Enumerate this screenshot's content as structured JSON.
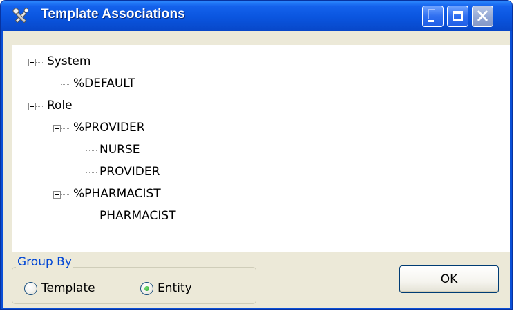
{
  "window": {
    "title": "Template Associations",
    "icon": "tools-icon",
    "controls": [
      "minimize-icon",
      "maximize-icon",
      "close-icon"
    ]
  },
  "tree": {
    "nodes": [
      {
        "label": "System",
        "level": 0,
        "expanded": true
      },
      {
        "label": "%DEFAULT",
        "level": 1
      },
      {
        "label": "Role",
        "level": 0,
        "expanded": true
      },
      {
        "label": "%PROVIDER",
        "level": 1,
        "expanded": true
      },
      {
        "label": "NURSE",
        "level": 2
      },
      {
        "label": "PROVIDER",
        "level": 2
      },
      {
        "label": "%PHARMACIST",
        "level": 1,
        "expanded": true
      },
      {
        "label": "PHARMACIST",
        "level": 2
      }
    ]
  },
  "group_by": {
    "title": "Group By",
    "options": [
      {
        "label": "Template",
        "checked": false
      },
      {
        "label": "Entity",
        "checked": true
      }
    ]
  },
  "buttons": {
    "ok_label": "OK"
  },
  "colors": {
    "title_bar": "#0a55df",
    "group_title": "#0046d5",
    "dialog_face": "#ece9d8"
  }
}
